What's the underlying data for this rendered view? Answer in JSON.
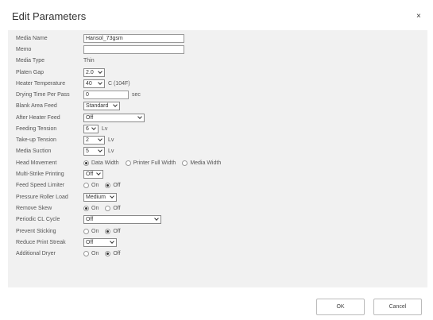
{
  "dialog": {
    "title": "Edit Parameters",
    "close_glyph": "×"
  },
  "fields": {
    "media_name": {
      "label": "Media Name",
      "value": "Hansol_73gsm"
    },
    "memo": {
      "label": "Memo",
      "value": ""
    },
    "media_type": {
      "label": "Media Type",
      "value": "Thin"
    },
    "platen_gap": {
      "label": "Platen Gap",
      "value": "2.0"
    },
    "heater_temperature": {
      "label": "Heater Temperature",
      "value": "40",
      "unit": "C (104F)"
    },
    "drying_time": {
      "label": "Drying Time Per Pass",
      "value": "0",
      "unit": "sec"
    },
    "blank_area_feed": {
      "label": "Blank Area Feed",
      "value": "Standard"
    },
    "after_heater_feed": {
      "label": "After Heater Feed",
      "value": "Off"
    },
    "feeding_tension": {
      "label": "Feeding Tension",
      "value": "6",
      "unit": "Lv"
    },
    "takeup_tension": {
      "label": "Take-up Tension",
      "value": "2",
      "unit": "Lv"
    },
    "media_suction": {
      "label": "Media Suction",
      "value": "5",
      "unit": "Lv"
    },
    "head_movement": {
      "label": "Head Movement",
      "options": [
        "Data Width",
        "Printer Full Width",
        "Media Width"
      ],
      "selected": "Data Width"
    },
    "multi_strike": {
      "label": "Multi-Strike Printing",
      "value": "Off"
    },
    "feed_speed_limiter": {
      "label": "Feed Speed Limiter",
      "options": [
        "On",
        "Off"
      ],
      "selected": "Off"
    },
    "pressure_roller_load": {
      "label": "Pressure Roller Load",
      "value": "Medium"
    },
    "remove_skew": {
      "label": "Remove Skew",
      "options": [
        "On",
        "Off"
      ],
      "selected": "On"
    },
    "periodic_cl_cycle": {
      "label": "Periodic CL Cycle",
      "value": "Off"
    },
    "prevent_sticking": {
      "label": "Prevent Sticking",
      "options": [
        "On",
        "Off"
      ],
      "selected": "Off"
    },
    "reduce_print_streak": {
      "label": "Reduce Print Streak",
      "value": "Off"
    },
    "additional_dryer": {
      "label": "Additional Dryer",
      "options": [
        "On",
        "Off"
      ],
      "selected": "Off"
    }
  },
  "footer": {
    "ok_label": "OK",
    "cancel_label": "Cancel"
  },
  "colors": {
    "panel": "#f1f1f1",
    "border": "#999999",
    "text": "#555555"
  }
}
